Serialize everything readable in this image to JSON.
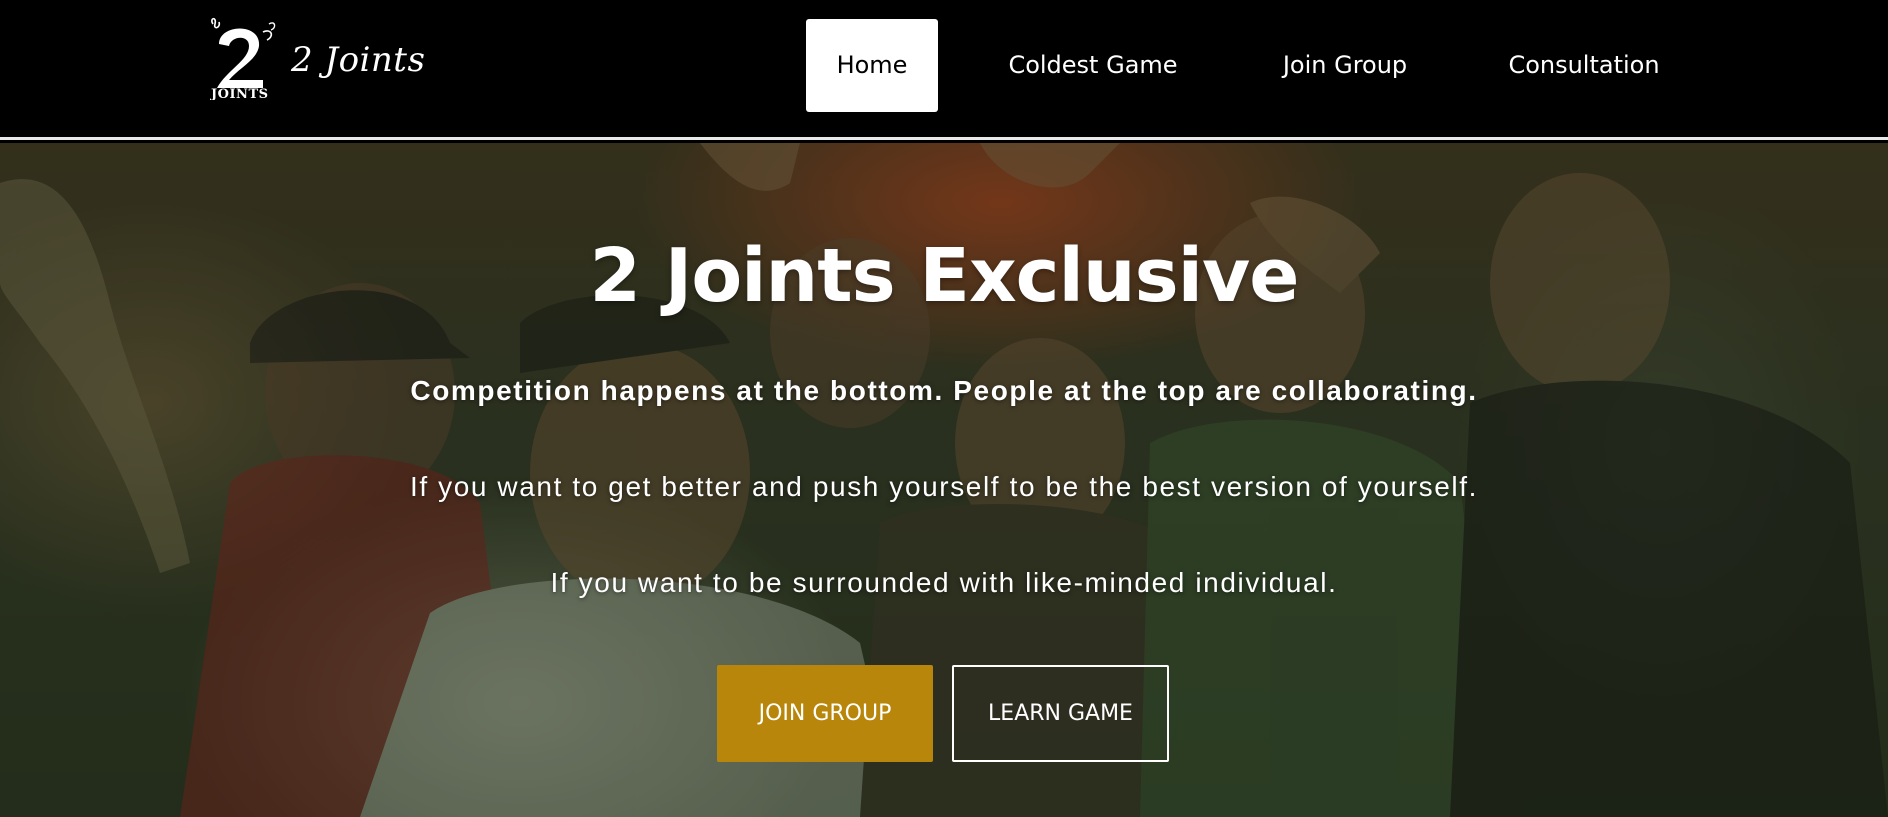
{
  "brand": {
    "logo_mark_name": "2-joints-logo-icon",
    "logo_mark_text": "2 JOINTS",
    "name": "2 Joints"
  },
  "nav": {
    "items": [
      {
        "label": "Home",
        "active": true
      },
      {
        "label": "Coldest Game",
        "active": false
      },
      {
        "label": "Join Group",
        "active": false
      },
      {
        "label": "Consultation",
        "active": false
      }
    ]
  },
  "hero": {
    "title": "2 Joints Exclusive",
    "lines": [
      "Competition happens at the bottom. People at the top are collaborating.",
      "If you want to get better and push yourself to be the best version of yourself.",
      "If you want to be surrounded with like-minded individual."
    ],
    "buttons": {
      "primary": "JOIN GROUP",
      "secondary": "LEARN GAME"
    },
    "background_description_icon": "group-photo-background"
  },
  "colors": {
    "header_bg": "#000000",
    "nav_active_bg": "#ffffff",
    "accent": "#b8860b",
    "text": "#ffffff"
  }
}
